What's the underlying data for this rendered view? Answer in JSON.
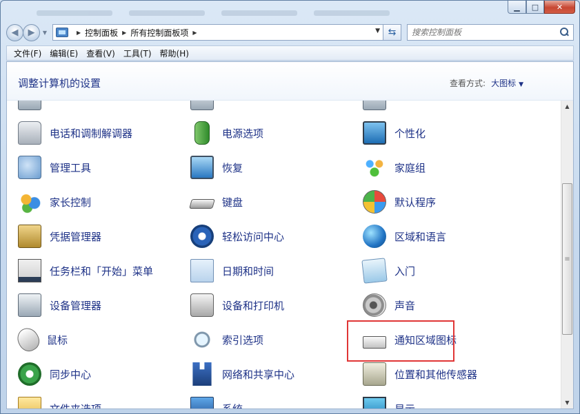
{
  "window": {
    "minimize_glyph": "▁",
    "maximize_glyph": "□",
    "close_glyph": "✕"
  },
  "address": {
    "breadcrumbs": [
      "控制面板",
      "所有控制面板项"
    ],
    "search_placeholder": "搜索控制面板"
  },
  "menu": [
    "文件(F)",
    "编辑(E)",
    "查看(V)",
    "工具(T)",
    "帮助(H)"
  ],
  "header": {
    "title": "调整计算机的设置",
    "view_label": "查看方式:",
    "view_value": "大图标"
  },
  "items": [
    {
      "label": "",
      "icon": "partial-icon"
    },
    {
      "label": "",
      "icon": "partial-icon"
    },
    {
      "label": "",
      "icon": "partial-icon"
    },
    {
      "label": "电话和调制解调器",
      "icon": "phone-modem-icon"
    },
    {
      "label": "电源选项",
      "icon": "battery-icon"
    },
    {
      "label": "个性化",
      "icon": "personalize-icon"
    },
    {
      "label": "管理工具",
      "icon": "admin-tools-icon"
    },
    {
      "label": "恢复",
      "icon": "recovery-icon"
    },
    {
      "label": "家庭组",
      "icon": "homegroup-icon"
    },
    {
      "label": "家长控制",
      "icon": "parental-control-icon"
    },
    {
      "label": "键盘",
      "icon": "keyboard-icon"
    },
    {
      "label": "默认程序",
      "icon": "default-programs-icon"
    },
    {
      "label": "凭据管理器",
      "icon": "credential-vault-icon"
    },
    {
      "label": "轻松访问中心",
      "icon": "ease-of-access-icon"
    },
    {
      "label": "区域和语言",
      "icon": "globe-clock-icon"
    },
    {
      "label": "任务栏和「开始」菜单",
      "icon": "taskbar-icon"
    },
    {
      "label": "日期和时间",
      "icon": "calendar-clock-icon"
    },
    {
      "label": "入门",
      "icon": "getting-started-icon"
    },
    {
      "label": "设备管理器",
      "icon": "device-manager-icon"
    },
    {
      "label": "设备和打印机",
      "icon": "printer-icon"
    },
    {
      "label": "声音",
      "icon": "speaker-icon"
    },
    {
      "label": "鼠标",
      "icon": "mouse-icon"
    },
    {
      "label": "索引选项",
      "icon": "indexing-icon"
    },
    {
      "label": "通知区域图标",
      "icon": "notification-area-icon"
    },
    {
      "label": "同步中心",
      "icon": "sync-icon"
    },
    {
      "label": "网络和共享中心",
      "icon": "network-icon"
    },
    {
      "label": "位置和其他传感器",
      "icon": "location-sensor-icon"
    },
    {
      "label": "文件夹选项",
      "icon": "folder-icon"
    },
    {
      "label": "系统",
      "icon": "system-icon"
    },
    {
      "label": "显示",
      "icon": "display-icon"
    }
  ],
  "highlight_color": "#e03535"
}
